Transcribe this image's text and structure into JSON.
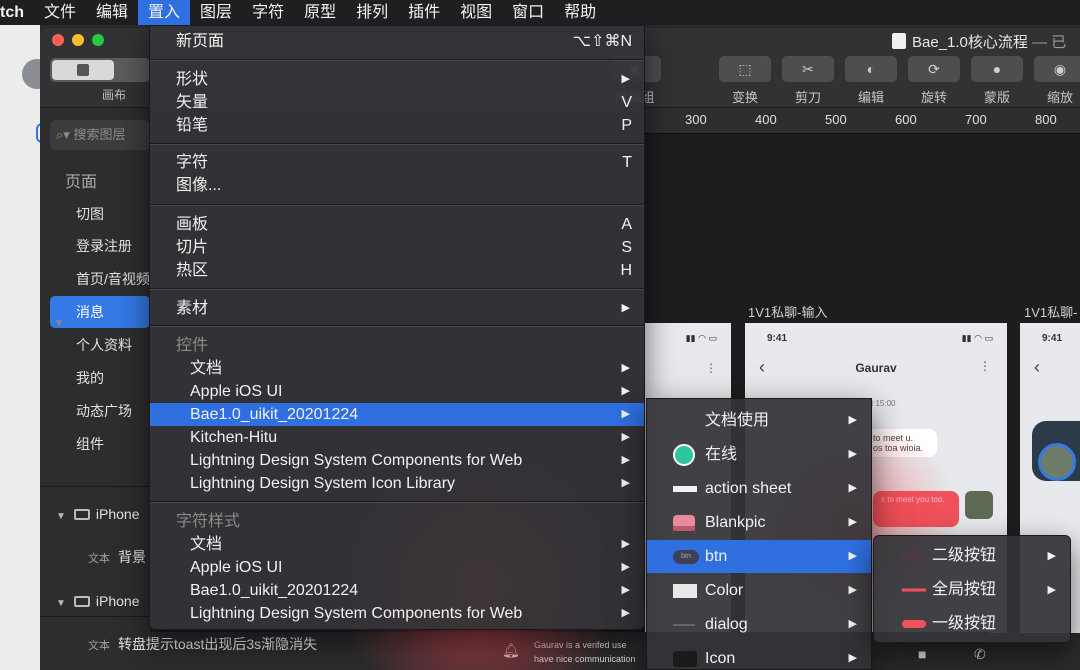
{
  "menubar": {
    "app": "tch",
    "items": [
      "文件",
      "编辑",
      "置入",
      "图层",
      "字符",
      "原型",
      "排列",
      "插件",
      "视图",
      "窗口",
      "帮助"
    ],
    "active_index": 2
  },
  "window": {
    "title": "Bae_1.0核心流程",
    "title_suffix": "— 已",
    "canvas_segment_label": "画布"
  },
  "toolbar": {
    "tools": [
      {
        "label": "除编组",
        "icon": "ungroup-icon"
      },
      {
        "label": "变换",
        "icon": "transform-icon"
      },
      {
        "label": "剪刀",
        "icon": "scissors-icon"
      },
      {
        "label": "编辑",
        "icon": "edit-icon"
      },
      {
        "label": "旋转",
        "icon": "rotate-icon"
      },
      {
        "label": "蒙版",
        "icon": "mask-icon"
      },
      {
        "label": "缩放",
        "icon": "scale-icon"
      }
    ]
  },
  "sidebar": {
    "search_placeholder": "搜索图层",
    "pages_heading": "页面",
    "pages": [
      "切图",
      "登录注册",
      "首页/音视频",
      "消息",
      "个人资料",
      "我的",
      "动态广场",
      "组件"
    ],
    "selected_page_index": 3,
    "artboards": [
      {
        "name": "iPhone",
        "layer_tag": "文本",
        "layer_text": "背景 2"
      },
      {
        "name": "iPhone",
        "layer_tag": "文本",
        "layer_text": "转盘提示toast出现后3s渐隐消失"
      }
    ]
  },
  "canvas": {
    "ruler_ticks": [
      "300",
      "400",
      "500",
      "600",
      "700",
      "800"
    ],
    "artboard_labels": [
      "1V1私聊-输入",
      "1V1私聊-"
    ],
    "phone": {
      "time": "9:41",
      "contact_name": "Gaurav",
      "timestamp": "t 15:00",
      "bubble_1": "to meet u.",
      "bubble_2": "os toa wioia.",
      "bubble_red": "s to meet you too.",
      "bottom_text_1": "Gaurav is a verifed use",
      "bottom_text_2": "have nice communication"
    }
  },
  "menu_main": {
    "new_page": {
      "label": "新页面",
      "shortcut": "⌥⇧⌘N"
    },
    "shape": {
      "label": "形状"
    },
    "vector": {
      "label": "矢量",
      "shortcut": "V"
    },
    "pencil": {
      "label": "铅笔",
      "shortcut": "P"
    },
    "text": {
      "label": "字符",
      "shortcut": "T"
    },
    "image": {
      "label": "图像..."
    },
    "artboard": {
      "label": "画板",
      "shortcut": "A"
    },
    "slice": {
      "label": "切片",
      "shortcut": "S"
    },
    "hotspot": {
      "label": "热区",
      "shortcut": "H"
    },
    "assets": {
      "label": "素材"
    },
    "symbols_heading": "控件",
    "symbols": [
      "文档",
      "Apple iOS UI",
      "Bae1.0_uikit_20201224",
      "Kitchen-Hitu",
      "Lightning Design System Components for Web",
      "Lightning Design System Icon Library"
    ],
    "symbols_highlight_index": 2,
    "text_styles_heading": "字符样式",
    "text_styles": [
      "文档",
      "Apple iOS UI",
      "Bae1.0_uikit_20201224",
      "Lightning Design System Components for Web"
    ]
  },
  "menu_sub": {
    "items": [
      {
        "label": "文档使用",
        "icon": "none"
      },
      {
        "label": "在线",
        "icon": "green-dot-icon"
      },
      {
        "label": "action sheet",
        "icon": "white-bar-icon"
      },
      {
        "label": "Blankpic",
        "icon": "cake-icon"
      },
      {
        "label": "btn",
        "icon": "btn-chip-icon"
      },
      {
        "label": "Color",
        "icon": "white-rect-icon"
      },
      {
        "label": "dialog",
        "icon": "dash-icon"
      },
      {
        "label": "Icon",
        "icon": "video-camera-icon"
      }
    ],
    "highlight_index": 4,
    "btn_chip_text": "btn"
  },
  "menu_sub2": {
    "items": [
      {
        "label": "二级按钮",
        "has_submenu": true
      },
      {
        "label": "全局按钮",
        "has_submenu": true
      },
      {
        "label": "一级按钮",
        "has_submenu": false
      }
    ]
  },
  "colors": {
    "accent": "#2f6fe0",
    "menu_bg": "#343438",
    "online_green": "#2cc5a0",
    "button_red": "#f0525b"
  }
}
